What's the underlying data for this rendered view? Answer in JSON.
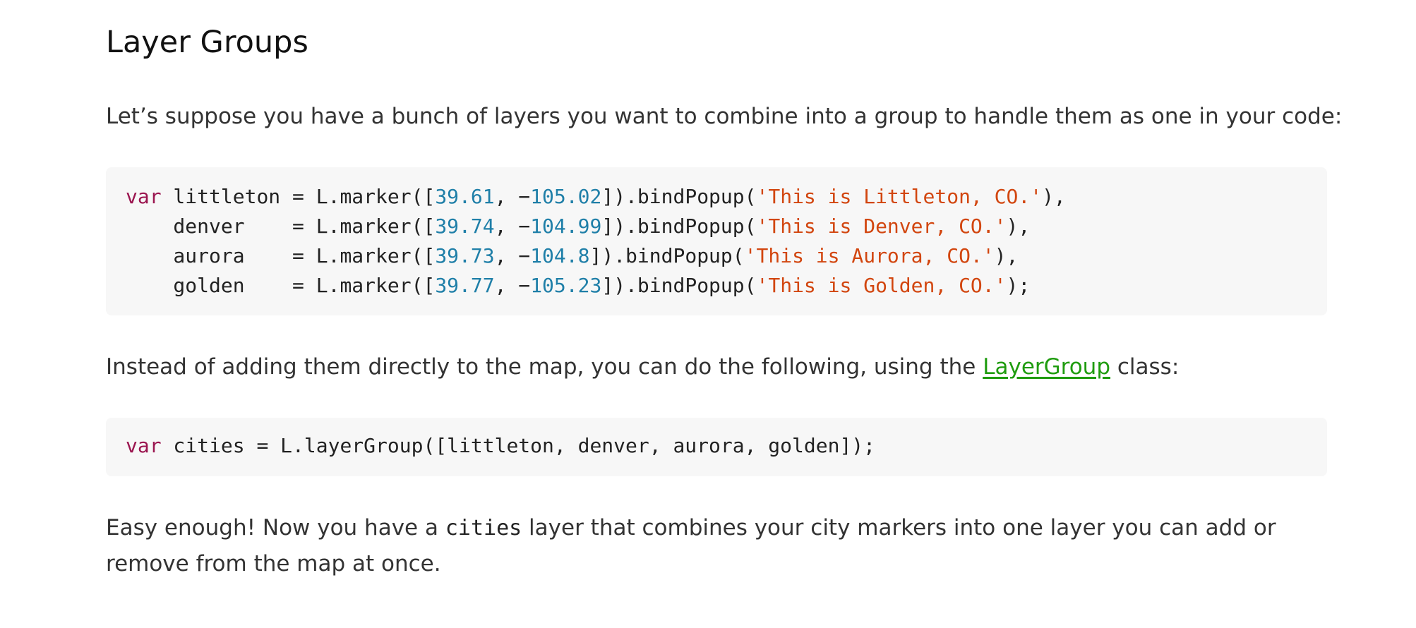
{
  "heading": "Layer Groups",
  "intro": "Let’s suppose you have a bunch of layers you want to combine into a group to handle them as one in your code:",
  "code_block_1": {
    "keyword": "var",
    "lines": [
      {
        "name": " littleton",
        "pad": " = ",
        "call": "L.marker([",
        "lat": "39.61",
        "sep": ", −",
        "lng": "105.02",
        "after": "]).bindPopup(",
        "popup": "'This is Littleton, CO.'",
        "end": "),"
      },
      {
        "name": "    denver",
        "pad": "    = ",
        "call": "L.marker([",
        "lat": "39.74",
        "sep": ", −",
        "lng": "104.99",
        "after": "]).bindPopup(",
        "popup": "'This is Denver, CO.'",
        "end": "),"
      },
      {
        "name": "    aurora",
        "pad": "    = ",
        "call": "L.marker([",
        "lat": "39.73",
        "sep": ", −",
        "lng": "104.8",
        "after": "]).bindPopup(",
        "popup": "'This is Aurora, CO.'",
        "end": "),"
      },
      {
        "name": "    golden",
        "pad": "    = ",
        "call": "L.marker([",
        "lat": "39.77",
        "sep": ", −",
        "lng": "105.23",
        "after": "]).bindPopup(",
        "popup": "'This is Golden, CO.'",
        "end": ");"
      }
    ]
  },
  "middle": {
    "before_link": "Instead of adding them directly to the map, you can do the following, using the ",
    "link_text": "LayerGroup",
    "after_link": " class:"
  },
  "code_block_2": {
    "keyword": "var",
    "rest": " cities = L.layerGroup([littleton, denver, aurora, golden]);"
  },
  "outro": {
    "before_code": "Easy enough! Now you have a ",
    "inline_code": "cities",
    "after_code": " layer that combines your city markers into one layer you can add or remove from the map at once."
  },
  "colors": {
    "keyword": "#9b1650",
    "number": "#1f7fa8",
    "string": "#d2460f",
    "link": "#1f9c0f",
    "code_background": "#f7f7f7"
  }
}
